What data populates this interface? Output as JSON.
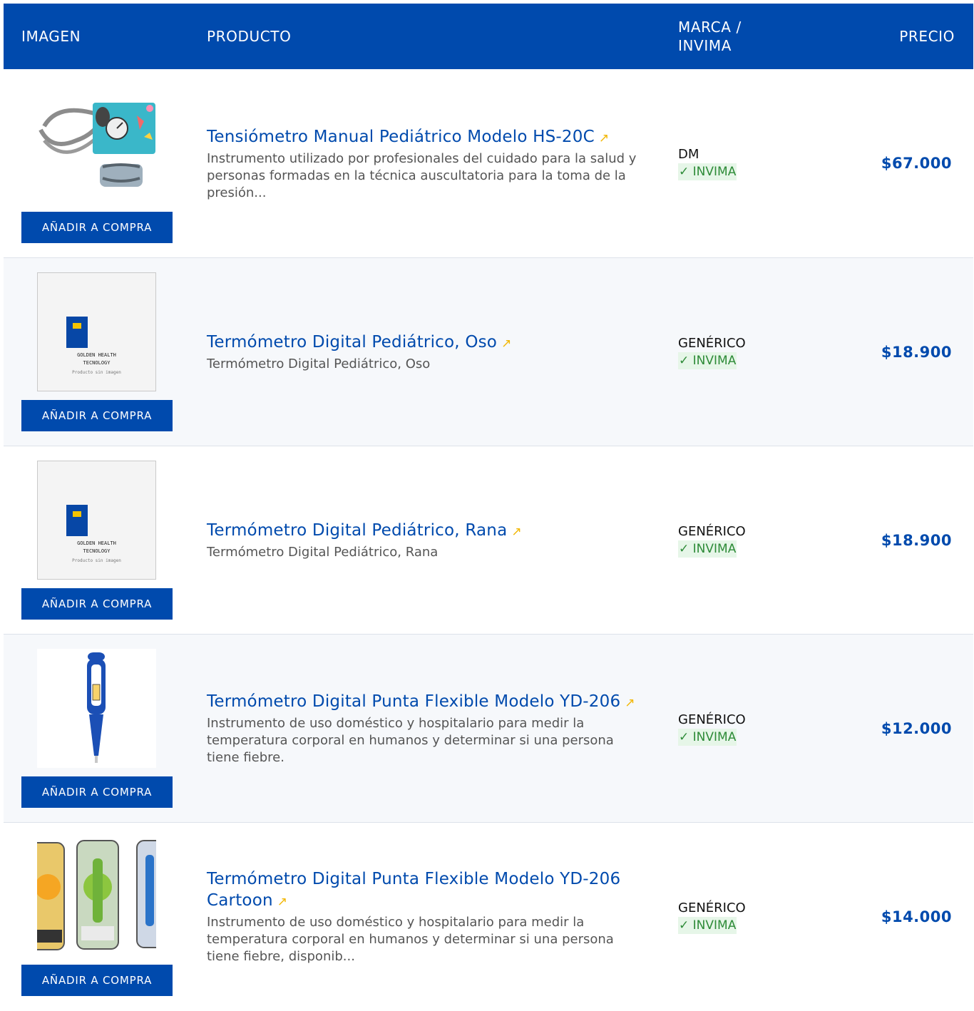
{
  "header": {
    "col_image": "IMAGEN",
    "col_product": "PRODUCTO",
    "col_brand": "MARCA / INVIMA",
    "col_price": "PRECIO"
  },
  "add_label": "AÑADIR A COMPRA",
  "placeholder": {
    "line1": "GOLDEN HEALTH",
    "line2": "TECNOLOGY",
    "line3": "Producto sin imagen"
  },
  "products": [
    {
      "title": "Tensiómetro Manual Pediátrico Modelo HS-20C",
      "description": "Instrumento utilizado por profesionales del cuidado para la salud y personas formadas en la técnica auscultatoria para la toma de la presión...",
      "brand": "DM",
      "invima": "✓ INVIMA",
      "price": "$67.000"
    },
    {
      "title": "Termómetro Digital Pediátrico, Oso",
      "description": "Termómetro Digital Pediátrico, Oso",
      "brand": "GENÉRICO",
      "invima": "✓ INVIMA",
      "price": "$18.900"
    },
    {
      "title": "Termómetro Digital Pediátrico, Rana",
      "description": "Termómetro Digital Pediátrico, Rana",
      "brand": "GENÉRICO",
      "invima": "✓ INVIMA",
      "price": "$18.900"
    },
    {
      "title": "Termómetro Digital Punta Flexible Modelo YD-206",
      "description": "Instrumento de uso doméstico y hospitalario para medir la temperatura corporal en humanos y determinar si una persona tiene fiebre.",
      "brand": "GENÉRICO",
      "invima": "✓ INVIMA",
      "price": "$12.000"
    },
    {
      "title": "Termómetro Digital Punta Flexible Modelo YD-206 Cartoon",
      "description": "Instrumento de uso doméstico y hospitalario para medir la temperatura corporal en humanos y determinar si una persona tiene fiebre, disponib...",
      "brand": "GENÉRICO",
      "invima": "✓ INVIMA",
      "price": "$14.000"
    }
  ],
  "icons": {
    "external_link": "external-link-icon",
    "check": "check-icon"
  },
  "colors": {
    "primary": "#004aad",
    "accent": "#f2b705",
    "invima_text": "#2e8b38",
    "invima_bg": "#e6f6e8"
  }
}
